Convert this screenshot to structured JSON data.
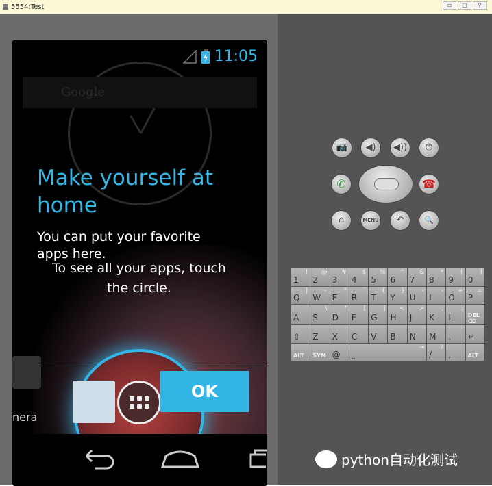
{
  "window": {
    "title": "5554:Test",
    "buttons": [
      "▭",
      "□",
      "⚲"
    ]
  },
  "status": {
    "time": "11:05"
  },
  "search": {
    "placeholder": "Google"
  },
  "tutorial": {
    "title": "Make yourself at home",
    "body": "You can put your favorite apps here.",
    "hint": "To see all your apps, touch the circle.",
    "ok": "OK"
  },
  "dock": {
    "camera_label": "nera"
  },
  "controls": {
    "row1": [
      "📷",
      "◀)",
      "◀))",
      "⏻"
    ],
    "row3": [
      "⌂",
      "MENU",
      "↶",
      "🔍"
    ]
  },
  "keyboard": [
    [
      {
        "k": "1",
        "s": "!"
      },
      {
        "k": "2",
        "s": "@"
      },
      {
        "k": "3",
        "s": "#"
      },
      {
        "k": "4",
        "s": "$"
      },
      {
        "k": "5",
        "s": "%"
      },
      {
        "k": "6",
        "s": "^"
      },
      {
        "k": "7",
        "s": "&"
      },
      {
        "k": "8",
        "s": "*"
      },
      {
        "k": "9",
        "s": "("
      },
      {
        "k": "0",
        "s": ")"
      }
    ],
    [
      {
        "k": "Q",
        "s": "|"
      },
      {
        "k": "W",
        "s": "~"
      },
      {
        "k": "E",
        "s": "\""
      },
      {
        "k": "R",
        "s": "`"
      },
      {
        "k": "T",
        "s": "{"
      },
      {
        "k": "Y",
        "s": "}"
      },
      {
        "k": "U",
        "s": "-"
      },
      {
        "k": "I",
        "s": "-"
      },
      {
        "k": "O",
        "s": "+"
      },
      {
        "k": "P",
        "s": "="
      }
    ],
    [
      {
        "k": "A",
        "s": ""
      },
      {
        "k": "S",
        "s": "\\"
      },
      {
        "k": "D",
        "s": "'"
      },
      {
        "k": "F",
        "s": "["
      },
      {
        "k": "G",
        "s": "]"
      },
      {
        "k": "H",
        "s": "<"
      },
      {
        "k": "J",
        "s": ">"
      },
      {
        "k": "K",
        "s": ";"
      },
      {
        "k": "L",
        "s": ":"
      },
      {
        "k": "DEL ⌫",
        "s": ""
      }
    ],
    [
      {
        "k": "⇧",
        "s": ""
      },
      {
        "k": "Z",
        "s": ""
      },
      {
        "k": "X",
        "s": ""
      },
      {
        "k": "C",
        "s": ""
      },
      {
        "k": "V",
        "s": ""
      },
      {
        "k": "B",
        "s": ""
      },
      {
        "k": "N",
        "s": ""
      },
      {
        "k": "M",
        "s": ""
      },
      {
        "k": ".",
        "s": ""
      },
      {
        "k": "↵",
        "s": ""
      }
    ],
    [
      {
        "k": "ALT",
        "s": ""
      },
      {
        "k": "SYM",
        "s": ""
      },
      {
        "k": "@",
        "s": ""
      },
      {
        "k": "⎵",
        "s": "⇥"
      },
      {
        "k": "/",
        "s": "?"
      },
      {
        "k": ",",
        "s": ""
      },
      {
        "k": "ALT",
        "s": ""
      }
    ]
  ],
  "watermark": "python自动化测试",
  "colors": {
    "accent": "#33b5e5",
    "call": "#2e9b3a",
    "endcall": "#d02020"
  }
}
